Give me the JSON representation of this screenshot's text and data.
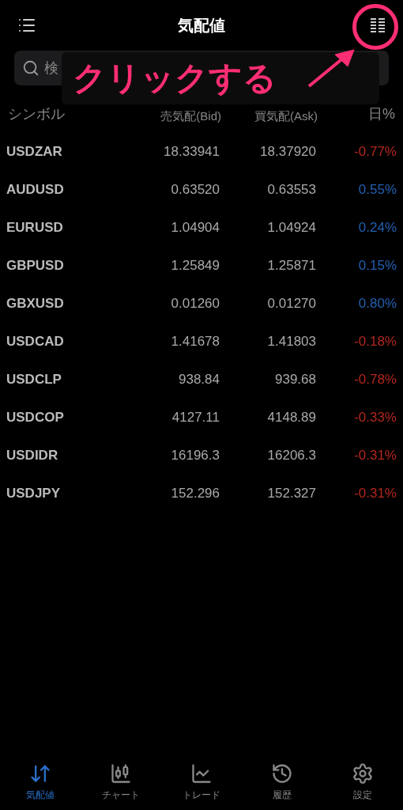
{
  "header": {
    "title": "気配値"
  },
  "search": {
    "placeholder": "検"
  },
  "annotation": {
    "text": "クリックする"
  },
  "table": {
    "columns": [
      "シンボル",
      "売気配(Bid)",
      "買気配(Ask)",
      "日%"
    ],
    "rows": [
      {
        "symbol": "USDZAR",
        "bid": "18.33941",
        "ask": "18.37920",
        "change": "-0.77%",
        "color": "#b3261e"
      },
      {
        "symbol": "AUDUSD",
        "bid": "0.63520",
        "ask": "0.63553",
        "change": "0.55%",
        "color": "#2360b0"
      },
      {
        "symbol": "EURUSD",
        "bid": "1.04904",
        "ask": "1.04924",
        "change": "0.24%",
        "color": "#2360b0"
      },
      {
        "symbol": "GBPUSD",
        "bid": "1.25849",
        "ask": "1.25871",
        "change": "0.15%",
        "color": "#2360b0"
      },
      {
        "symbol": "GBXUSD",
        "bid": "0.01260",
        "ask": "0.01270",
        "change": "0.80%",
        "color": "#2360b0"
      },
      {
        "symbol": "USDCAD",
        "bid": "1.41678",
        "ask": "1.41803",
        "change": "-0.18%",
        "color": "#b3261e"
      },
      {
        "symbol": "USDCLP",
        "bid": "938.84",
        "ask": "939.68",
        "change": "-0.78%",
        "color": "#b3261e"
      },
      {
        "symbol": "USDCOP",
        "bid": "4127.11",
        "ask": "4148.89",
        "change": "-0.33%",
        "color": "#b3261e"
      },
      {
        "symbol": "USDIDR",
        "bid": "16196.3",
        "ask": "16206.3",
        "change": "-0.31%",
        "color": "#b3261e"
      },
      {
        "symbol": "USDJPY",
        "bid": "152.296",
        "ask": "152.327",
        "change": "-0.31%",
        "color": "#b3261e"
      }
    ]
  },
  "tabbar": [
    {
      "kind": "quotes",
      "label": "気配値",
      "selected": true
    },
    {
      "kind": "chart",
      "label": "チャート",
      "selected": false
    },
    {
      "kind": "trade",
      "label": "トレード",
      "selected": false
    },
    {
      "kind": "history",
      "label": "履歴",
      "selected": false
    },
    {
      "kind": "settings",
      "label": "設定",
      "selected": false
    }
  ]
}
